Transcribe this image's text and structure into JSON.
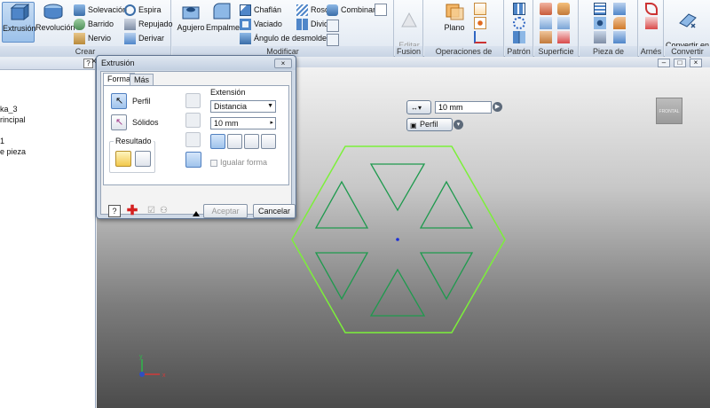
{
  "ribbon": {
    "crear": {
      "title": "Crear",
      "extrusion": "Extrusión",
      "revolucion": "Revolución",
      "solevacion": "Solevación",
      "barrido": "Barrido",
      "nervio": "Nervio",
      "espira": "Espira",
      "repujado": "Repujado",
      "derivar": "Derivar"
    },
    "modificar": {
      "title": "Modificar",
      "agujero": "Agujero",
      "empalme": "Empalme",
      "chaflan": "Chaflán",
      "vaciado": "Vaciado",
      "angulo": "Ángulo de desmoldeo",
      "rosca": "Rosca",
      "dividir": "Dividir",
      "combinar": "Combinar"
    },
    "fusion": {
      "title": "Fusion",
      "editar": "Editar\nforma"
    },
    "operaciones": {
      "title": "Operaciones de trabajo",
      "plano": "Plano"
    },
    "patron": {
      "title": "Patrón"
    },
    "superficie": {
      "title": "Superficie"
    },
    "plastico": {
      "title": "Pieza de plástico"
    },
    "arnes": {
      "title": "Arnés"
    },
    "convertir": {
      "title": "Convertir",
      "chapa": "Convertir en\nchapa"
    }
  },
  "browser": {
    "close": "×",
    "help": "?",
    "items": [
      "ka_3",
      "rincipal",
      "",
      "1",
      "e pieza"
    ]
  },
  "viewport": {
    "viewcube": "FRONTAL",
    "mini_distance_value": "10 mm",
    "mini_profile": "Perfil"
  },
  "dialog": {
    "title": "Extrusión",
    "close": "×",
    "tabs": [
      "Forma",
      "Más"
    ],
    "perfil": "Perfil",
    "solidos": "Sólidos",
    "resultado": "Resultado",
    "extension": "Extensión",
    "extension_type": "Distancia",
    "distance": "10 mm",
    "igualar_forma": "Igualar forma",
    "aceptar": "Aceptar",
    "cancelar": "Cancelar"
  },
  "colors": {
    "sketch_outer": "#7cf03a",
    "sketch_inner": "#1f9a4e",
    "accent": "#2f66c2"
  }
}
